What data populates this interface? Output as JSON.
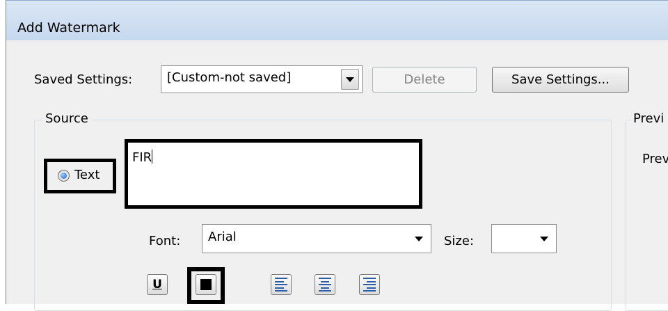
{
  "window": {
    "title": "Add Watermark"
  },
  "saved_settings": {
    "label": "Saved Settings:",
    "selected": "[Custom-not saved]",
    "delete_label": "Delete",
    "save_label": "Save Settings..."
  },
  "source": {
    "group_label": "Source",
    "text_radio_label": "Text",
    "text_value": "FIR",
    "font_label": "Font:",
    "font_value": "Arial",
    "size_label": "Size:",
    "size_value": "",
    "underline_label": "U"
  },
  "preview": {
    "group_label": "Previ",
    "inner_label": "Prev"
  },
  "colors": {
    "window_bg": "#f0f0f0",
    "titlebar": "#c6d8ee",
    "highlight": "#000000",
    "radio_dot": "#1a5fb4"
  }
}
